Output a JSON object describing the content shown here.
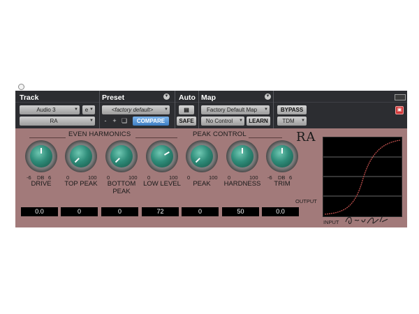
{
  "header": {
    "track": {
      "label": "Track",
      "track_name": "Audio 3",
      "track_suffix": "e",
      "insert": "RA"
    },
    "preset": {
      "label": "Preset",
      "value": "<factory default>",
      "minus": "-",
      "plus": "+",
      "compare": "COMPARE"
    },
    "auto": {
      "label": "Auto",
      "safe": "SAFE"
    },
    "map": {
      "label": "Map",
      "value": "Factory Default Map",
      "control": "No Control",
      "learn": "LEARN"
    },
    "bypass": "BYPASS",
    "format": "TDM"
  },
  "plugin": {
    "logo": "RA",
    "groups": {
      "even_harmonics": "EVEN HARMONICS",
      "peak_control": "PEAK CONTROL"
    },
    "knobs": [
      {
        "id": "drive",
        "scale_min": "-6",
        "scale_mid": "DB",
        "scale_max": "6",
        "label": "DRIVE",
        "value": "0.0",
        "level": 0.5
      },
      {
        "id": "top-peak",
        "scale_min": "0",
        "scale_mid": "",
        "scale_max": "100",
        "label": "TOP PEAK",
        "value": "0",
        "level": 0.0
      },
      {
        "id": "bottom-peak",
        "scale_min": "0",
        "scale_mid": "",
        "scale_max": "100",
        "label": "BOTTOM PEAK",
        "value": "0",
        "level": 0.0
      },
      {
        "id": "low-level",
        "scale_min": "0",
        "scale_mid": "",
        "scale_max": "100",
        "label": "LOW LEVEL",
        "value": "72",
        "level": 0.72
      },
      {
        "id": "peak",
        "scale_min": "0",
        "scale_mid": "",
        "scale_max": "100",
        "label": "PEAK",
        "value": "0",
        "level": 0.0
      },
      {
        "id": "hardness",
        "scale_min": "0",
        "scale_mid": "",
        "scale_max": "100",
        "label": "HARDNESS",
        "value": "50",
        "level": 0.5
      },
      {
        "id": "trim",
        "scale_min": "-6",
        "scale_mid": "DB",
        "scale_max": "6",
        "label": "TRIM",
        "value": "0.0",
        "level": 0.5
      }
    ],
    "graph": {
      "output_label": "OUTPUT",
      "input_label": "INPUT"
    }
  }
}
